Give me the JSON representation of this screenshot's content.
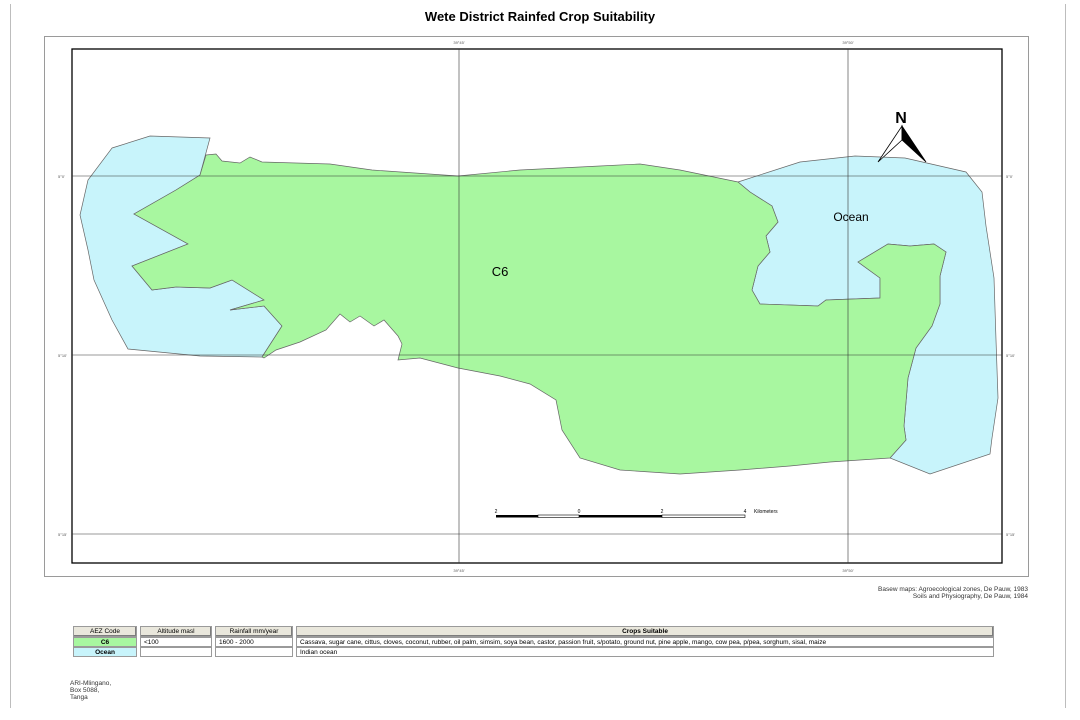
{
  "map": {
    "title": "Wete District Rainfed Crop Suitability",
    "labels": {
      "c6": "C6",
      "ocean": "Ocean"
    },
    "north_arrow_label": "N",
    "scale_bar": {
      "ticks": [
        "2",
        "0",
        "2",
        "4"
      ],
      "unit": "Kilometers"
    },
    "grid_labels": {
      "top": [
        "39°45'",
        "39°50'"
      ],
      "bottom": [
        "39°45'",
        "39°50'"
      ],
      "left": [
        "5°0'",
        "5°10'",
        "5°15'"
      ],
      "right": [
        "5°0'",
        "5°10'",
        "5°15'"
      ]
    },
    "colors": {
      "c6": "#a8f7a0",
      "ocean": "#c8f4fb",
      "outline": "#666666"
    }
  },
  "credits": [
    "Basew maps: Agroecological zones, De Pauw, 1983",
    "Soils and Physiography, De Pauw, 1984"
  ],
  "legend": {
    "headers": {
      "code": "AEZ Code",
      "altitude": "Altitude masl",
      "rainfall": "Rainfall mm/year",
      "crops": "Crops Suitable"
    },
    "rows": [
      {
        "code": "C6",
        "altitude": "<100",
        "rainfall": "1600 - 2000",
        "crops": "Cassava, sugar cane, cittus, cloves, coconut, rubber, oil palm, simsim, soya bean, castor, passion fruit, s/potato, ground nut, pine apple, mango, cow pea, p/pea, sorghum, sisal, maize"
      },
      {
        "code": "Ocean",
        "altitude": "",
        "rainfall": "",
        "crops": "Indian ocean"
      }
    ]
  },
  "address": [
    "ARI-Mlingano,",
    "Box 5088,",
    "Tanga"
  ]
}
